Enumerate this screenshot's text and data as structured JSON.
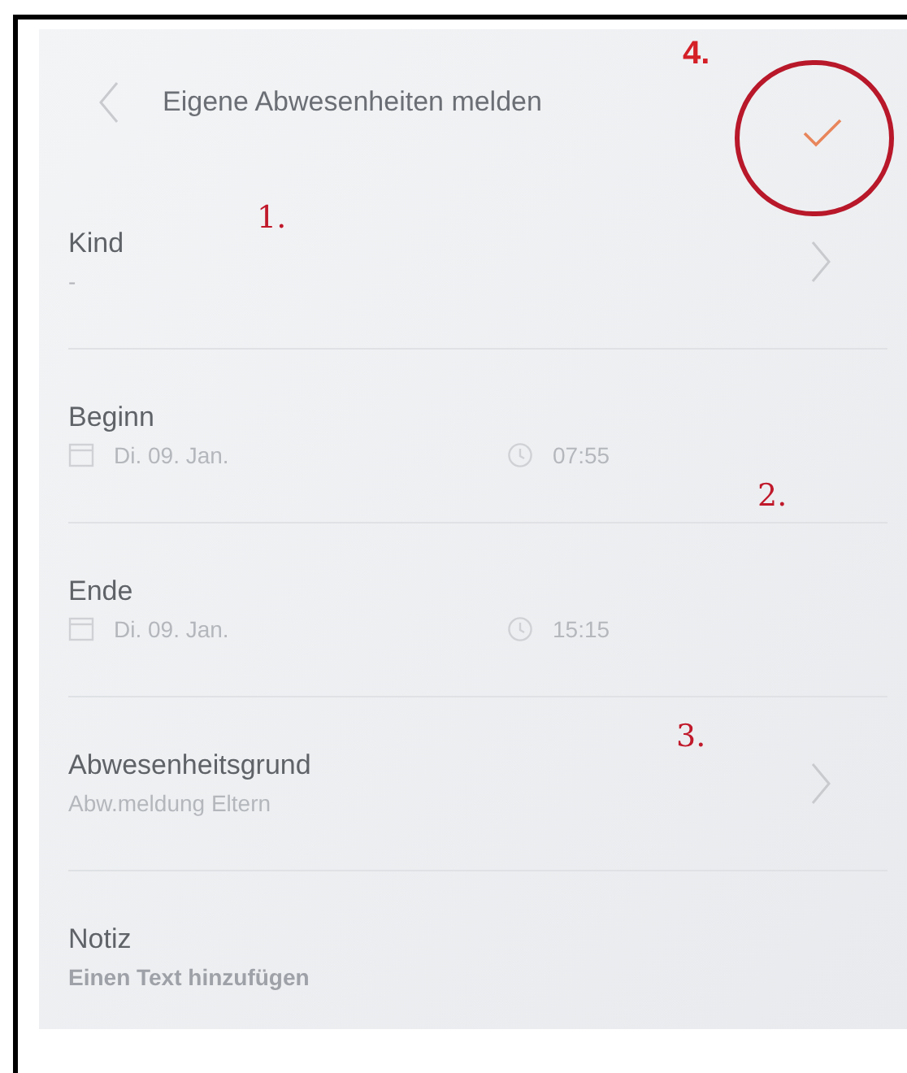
{
  "header": {
    "title": "Eigene Abwesenheiten melden",
    "annotation": "4."
  },
  "rows": [
    {
      "kind": "select",
      "label": "Kind",
      "value": "-",
      "annotation": "1."
    },
    {
      "kind": "datetime",
      "label": "Beginn",
      "date": "Di. 09. Jan.",
      "time": "07:55",
      "annotation": "2."
    },
    {
      "kind": "datetime",
      "label": "Ende",
      "date": "Di. 09. Jan.",
      "time": "15:15"
    },
    {
      "kind": "select",
      "label": "Abwesenheitsgrund",
      "value": "Abw.meldung Eltern",
      "annotation": "3."
    },
    {
      "kind": "note",
      "label": "Notiz",
      "value": "Einen Text hinzufügen"
    }
  ]
}
